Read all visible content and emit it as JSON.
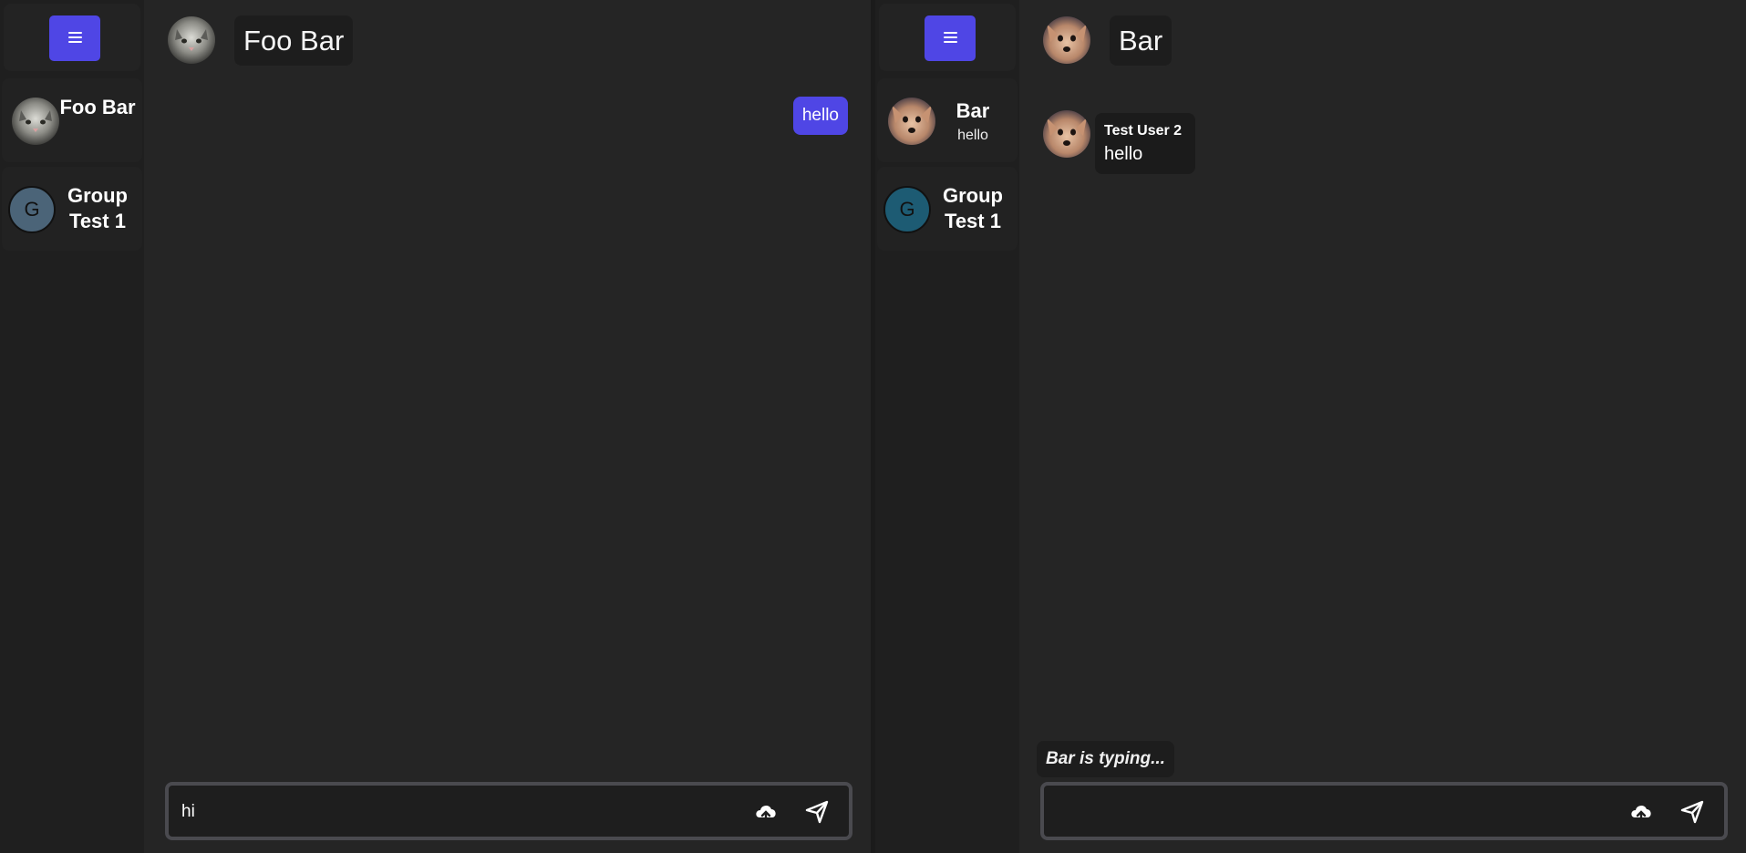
{
  "colors": {
    "accent": "#4f46e5",
    "background": "#252525",
    "sidebar": "#1f1f1f"
  },
  "icons": {
    "menu": "hamburger-menu-icon",
    "upload": "cloud-upload-icon",
    "send": "send-icon"
  },
  "left": {
    "chats": [
      {
        "name": "Foo Bar",
        "avatar": "cat-avatar"
      },
      {
        "name": "Group Test 1",
        "avatar_letter": "G",
        "avatar_color": "#4b6478"
      }
    ],
    "header": {
      "title": "Foo Bar"
    },
    "messages": [
      {
        "direction": "outgoing",
        "text": "hello"
      }
    ],
    "composer": {
      "value": "hi"
    }
  },
  "right": {
    "chats": [
      {
        "name": "Bar",
        "preview": "hello",
        "avatar": "dog-avatar"
      },
      {
        "name": "Group Test 1",
        "avatar_letter": "G",
        "avatar_color": "#1d5b73"
      }
    ],
    "header": {
      "title": "Bar"
    },
    "messages": [
      {
        "direction": "incoming",
        "sender": "Test User 2",
        "text": "hello"
      }
    ],
    "typing": "Bar is typing...",
    "composer": {
      "value": ""
    }
  }
}
